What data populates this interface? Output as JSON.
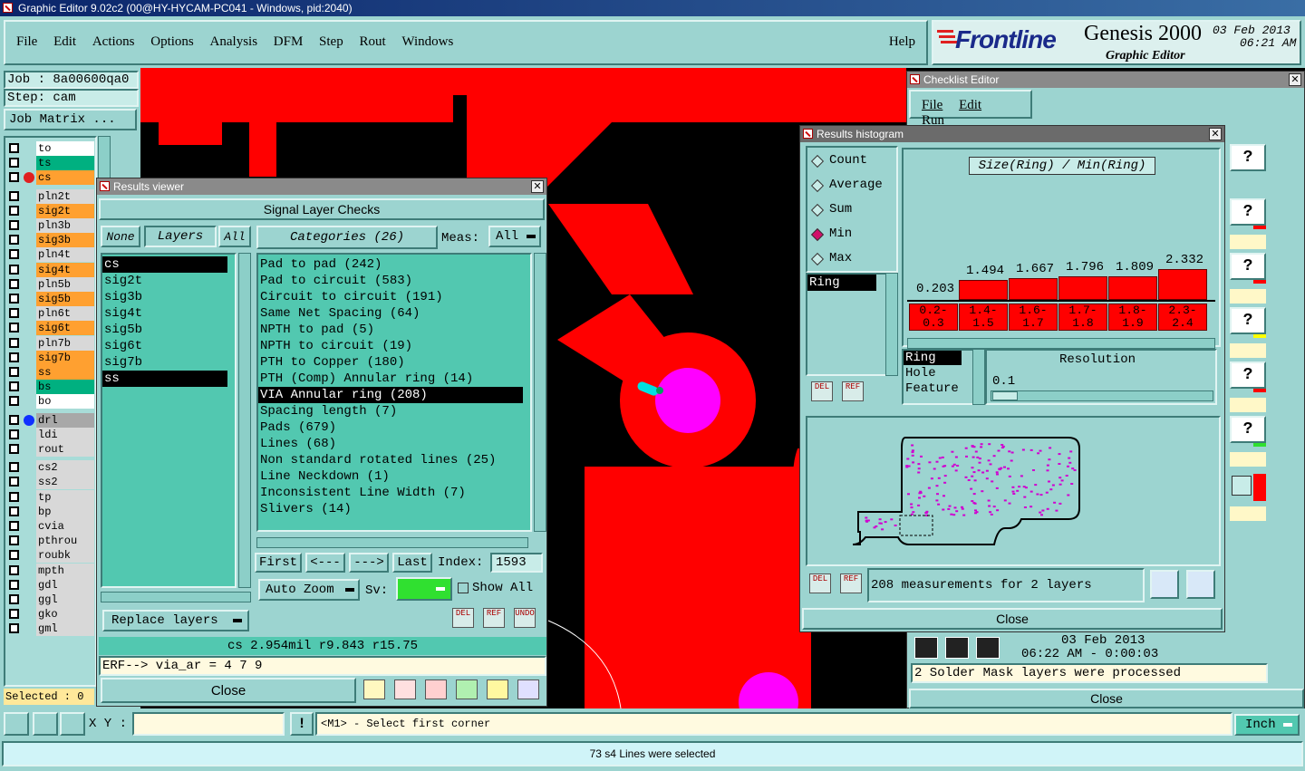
{
  "window": {
    "title": "Graphic Editor 9.02c2 (00@HY-HYCAM-PC041 - Windows, pid:2040)"
  },
  "menu": {
    "items": [
      "File",
      "Edit",
      "Actions",
      "Options",
      "Analysis",
      "DFM",
      "Step",
      "Rout",
      "Windows"
    ],
    "help": "Help"
  },
  "brand": {
    "logo": "Frontline",
    "product": "Genesis 2000",
    "sub": "Graphic Editor",
    "date": "03 Feb 2013",
    "time": "06:21 AM"
  },
  "job": {
    "job": "Job : 8a00600qa0",
    "step": "Step: cam",
    "matrix": "Job Matrix ..."
  },
  "layers": [
    {
      "name": "to",
      "color": "#ffffff"
    },
    {
      "name": "ts",
      "color": "#00b080"
    },
    {
      "name": "cs",
      "color": "#ffa030",
      "dot": true
    },
    {
      "name": "pln2t",
      "color": "#d8d8d8"
    },
    {
      "name": "sig2t",
      "color": "#ffa030"
    },
    {
      "name": "pln3b",
      "color": "#d8d8d8"
    },
    {
      "name": "sig3b",
      "color": "#ffa030"
    },
    {
      "name": "pln4t",
      "color": "#d8d8d8"
    },
    {
      "name": "sig4t",
      "color": "#ffa030"
    },
    {
      "name": "pln5b",
      "color": "#d8d8d8"
    },
    {
      "name": "sig5b",
      "color": "#ffa030"
    },
    {
      "name": "pln6t",
      "color": "#d8d8d8"
    },
    {
      "name": "sig6t",
      "color": "#ffa030"
    },
    {
      "name": "pln7b",
      "color": "#d8d8d8"
    },
    {
      "name": "sig7b",
      "color": "#ffa030"
    },
    {
      "name": "ss",
      "color": "#ffa030"
    },
    {
      "name": "bs",
      "color": "#00b080"
    },
    {
      "name": "bo",
      "color": "#ffffff"
    },
    {
      "name": "drl",
      "color": "#a8a8a8",
      "dot": true
    },
    {
      "name": "ldi",
      "color": "#d8d8d8"
    },
    {
      "name": "rout",
      "color": "#d8d8d8"
    },
    {
      "name": "cs2",
      "color": "#d8d8d8"
    },
    {
      "name": "ss2",
      "color": "#d8d8d8"
    },
    {
      "name": "tp",
      "color": "#d8d8d8"
    },
    {
      "name": "bp",
      "color": "#d8d8d8"
    },
    {
      "name": "cvia",
      "color": "#d8d8d8"
    },
    {
      "name": "pthrou",
      "color": "#d8d8d8"
    },
    {
      "name": "roubk",
      "color": "#d8d8d8"
    },
    {
      "name": "mpth",
      "color": "#d8d8d8"
    },
    {
      "name": "gdl",
      "color": "#d8d8d8"
    },
    {
      "name": "ggl",
      "color": "#d8d8d8"
    },
    {
      "name": "gko",
      "color": "#d8d8d8"
    },
    {
      "name": "gml",
      "color": "#d8d8d8"
    }
  ],
  "selected": "Selected : 0",
  "results_viewer": {
    "title": "Results viewer",
    "header": "Signal Layer Checks",
    "none": "None",
    "layers": "Layers",
    "all": "All",
    "categories": "Categories (26)",
    "meas_label": "Meas:",
    "meas_value": "All",
    "layer_list": [
      "cs",
      "sig2t",
      "sig3b",
      "sig4t",
      "sig5b",
      "sig6t",
      "sig7b",
      "ss"
    ],
    "category_list": [
      "Pad to pad (242)",
      "Pad to circuit (583)",
      "Circuit to circuit (191)",
      "Same Net Spacing (64)",
      "NPTH to pad (5)",
      "NPTH to circuit (19)",
      "PTH to Copper (180)",
      "PTH (Comp) Annular ring (14)",
      "VIA Annular ring (208)",
      "Spacing length (7)",
      "Pads (679)",
      "Lines (68)",
      "Non standard rotated lines (25)",
      "Line Neckdown (1)",
      "Inconsistent Line Width (7)",
      "Slivers (14)"
    ],
    "first": "First",
    "prev": "<---",
    "next": "--->",
    "last": "Last",
    "index_label": "Index:",
    "index_value": "1593",
    "auto_zoom": "Auto Zoom",
    "sv_label": "Sv:",
    "show_all": "Show All",
    "replace_layers": "Replace layers",
    "del": "DEL",
    "ref": "REF",
    "undo": "UNDO",
    "status": "cs 2.954mil  r9.843  r15.75",
    "erf": "ERF--> via_ar = 4 7 9",
    "close": "Close"
  },
  "checklist": {
    "title": "Checklist Editor",
    "menu": [
      "File",
      "Edit",
      "Run"
    ],
    "date": "03 Feb 2013",
    "time": "06:22 AM - 0:00:03",
    "message": "2 Solder Mask layers were processed",
    "close": "Close"
  },
  "histogram": {
    "title": "Results histogram",
    "modes": [
      "Count",
      "Average",
      "Sum",
      "Min",
      "Max"
    ],
    "selected_mode": "Min",
    "heading": "Size(Ring) / Min(Ring)",
    "list_item": "Ring",
    "bins": [
      "0.2-\n0.3",
      "1.4-\n1.5",
      "1.6-\n1.7",
      "1.7-\n1.8",
      "1.8-\n1.9",
      "2.3-\n2.4"
    ],
    "bin_values": [
      0.203,
      1.494,
      1.667,
      1.796,
      1.809,
      2.332
    ],
    "bin_labels": [
      "0.203",
      "1.494",
      "1.667",
      "1.796",
      "1.809",
      "2.332"
    ],
    "types": [
      "Ring",
      "Hole",
      "Feature"
    ],
    "resolution_label": "Resolution",
    "resolution_value": "0.1",
    "del": "DEL",
    "ref": "REF",
    "measurements": "208 measurements for 2 layers",
    "close": "Close"
  },
  "bottom": {
    "xy_label": "X Y :",
    "xy_value": "",
    "prompt": "<M1> - Select first corner",
    "units": "Inch",
    "status": "73 s4 Lines were selected"
  }
}
